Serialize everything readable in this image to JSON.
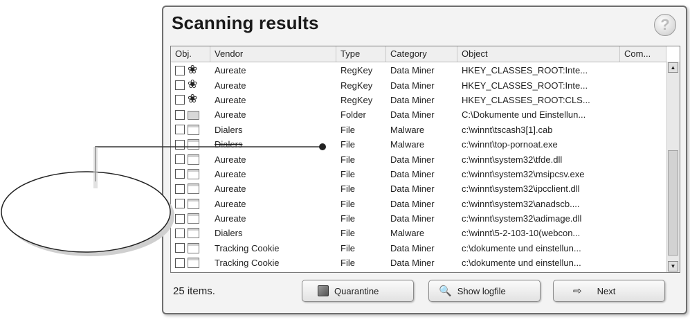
{
  "window": {
    "title": "Scanning results"
  },
  "columns": [
    "Obj.",
    "Vendor",
    "Type",
    "Category",
    "Object",
    "Com..."
  ],
  "rows": [
    {
      "icon": "registry-icon",
      "vendor": "Aureate",
      "type": "RegKey",
      "category": "Data Miner",
      "object": "HKEY_CLASSES_ROOT:Inte..."
    },
    {
      "icon": "registry-icon",
      "vendor": "Aureate",
      "type": "RegKey",
      "category": "Data Miner",
      "object": "HKEY_CLASSES_ROOT:Inte..."
    },
    {
      "icon": "registry-icon",
      "vendor": "Aureate",
      "type": "RegKey",
      "category": "Data Miner",
      "object": "HKEY_CLASSES_ROOT:CLS..."
    },
    {
      "icon": "folder-icon",
      "vendor": "Aureate",
      "type": "Folder",
      "category": "Data Miner",
      "object": "C:\\Dokumente und Einstellun..."
    },
    {
      "icon": "file-icon",
      "vendor": "Dialers",
      "type": "File",
      "category": "Malware",
      "object": "c:\\winnt\\tscash3[1].cab"
    },
    {
      "icon": "file-icon",
      "vendor": "Dialers",
      "type": "File",
      "category": "Malware",
      "object": "c:\\winnt\\top-pornoat.exe"
    },
    {
      "icon": "file-icon",
      "vendor": "Aureate",
      "type": "File",
      "category": "Data Miner",
      "object": "c:\\winnt\\system32\\tfde.dll"
    },
    {
      "icon": "file-icon",
      "vendor": "Aureate",
      "type": "File",
      "category": "Data Miner",
      "object": "c:\\winnt\\system32\\msipcsv.exe"
    },
    {
      "icon": "file-icon",
      "vendor": "Aureate",
      "type": "File",
      "category": "Data Miner",
      "object": "c:\\winnt\\system32\\ipcclient.dll"
    },
    {
      "icon": "file-icon",
      "vendor": "Aureate",
      "type": "File",
      "category": "Data Miner",
      "object": "c:\\winnt\\system32\\anadscb...."
    },
    {
      "icon": "file-icon",
      "vendor": "Aureate",
      "type": "File",
      "category": "Data Miner",
      "object": "c:\\winnt\\system32\\adimage.dll"
    },
    {
      "icon": "file-icon",
      "vendor": "Dialers",
      "type": "File",
      "category": "Malware",
      "object": "c:\\winnt\\5-2-103-10(webcon..."
    },
    {
      "icon": "file-icon",
      "vendor": "Tracking Cookie",
      "type": "File",
      "category": "Data Miner",
      "object": "c:\\dokumente und einstellun..."
    },
    {
      "icon": "file-icon",
      "vendor": "Tracking Cookie",
      "type": "File",
      "category": "Data Miner",
      "object": "c:\\dokumente und einstellun..."
    }
  ],
  "footer": {
    "count": "25 items.",
    "quarantine_label": "Quarantine",
    "logfile_label": "Show logfile",
    "next_label": "Next"
  },
  "icons": {
    "help": "help-icon",
    "quarantine": "cube-icon",
    "logfile": "magnifier-icon",
    "next": "arrow-right-icon"
  }
}
